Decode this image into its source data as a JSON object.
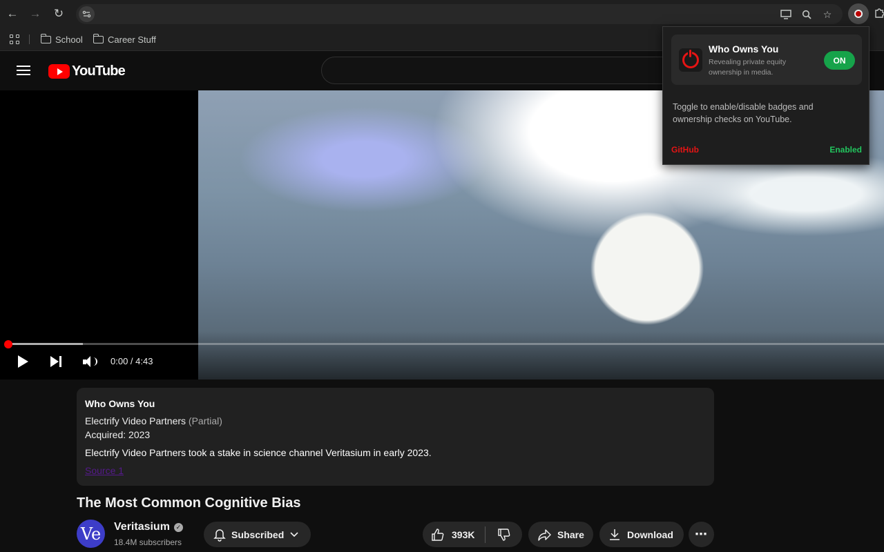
{
  "browser": {
    "bookmarks": [
      {
        "label": "School"
      },
      {
        "label": "Career Stuff"
      }
    ]
  },
  "youtube": {
    "logo_text": "YouTube"
  },
  "player": {
    "time": "0:00 / 4:43",
    "progress_fraction": 0.0,
    "buffered_fraction": 0.085
  },
  "owner_card": {
    "title": "Who Owns You",
    "owner": "Electrify Video Partners",
    "stake": "(Partial)",
    "acquired": "Acquired: 2023",
    "description": "Electrify Video Partners took a stake in science channel Veritasium in early 2023.",
    "source_link": "Source 1"
  },
  "video": {
    "title": "The Most Common Cognitive Bias",
    "channel_initials": "Ve",
    "channel_name": "Veritasium",
    "subscribers": "18.4M subscribers",
    "subscribe_label": "Subscribed",
    "likes": "393K",
    "share_label": "Share",
    "download_label": "Download"
  },
  "extension_popup": {
    "title": "Who Owns You",
    "subtitle": "Revealing private equity ownership in media.",
    "toggle_label": "ON",
    "body": "Toggle to enable/disable badges and ownership checks on YouTube.",
    "github_link": "GitHub",
    "status": "Enabled",
    "colors": {
      "accent": "#e51414",
      "on": "#16a34a",
      "status": "#22c55e"
    }
  }
}
